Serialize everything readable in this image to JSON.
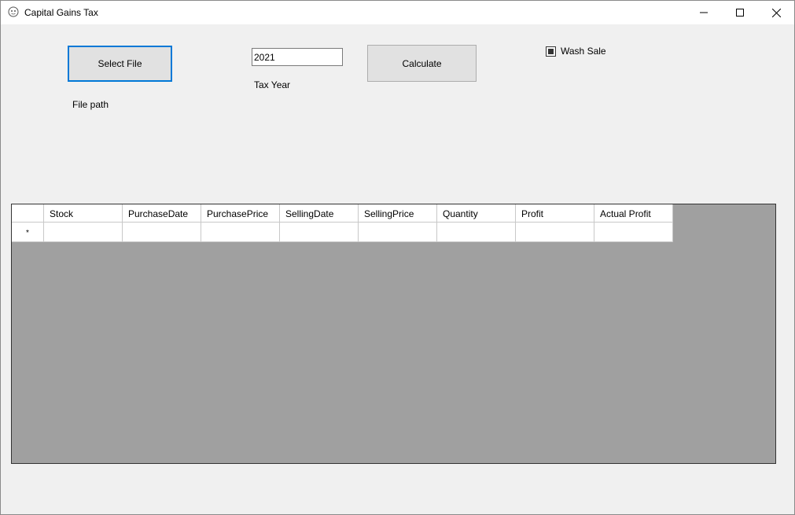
{
  "window": {
    "title": "Capital Gains Tax",
    "icon": "app-icon",
    "controls": [
      "minimize-icon",
      "maximize-icon",
      "close-icon"
    ]
  },
  "form": {
    "select_file_label": "Select File",
    "file_path_label": "File path",
    "tax_year_value": "2021",
    "tax_year_label": "Tax Year",
    "calculate_label": "Calculate",
    "wash_sale_label": "Wash Sale",
    "wash_sale_checked": true
  },
  "grid": {
    "columns": [
      "Stock",
      "PurchaseDate",
      "PurchasePrice",
      "SellingDate",
      "SellingPrice",
      "Quantity",
      "Profit",
      "Actual Profit"
    ],
    "new_row_marker": "*",
    "rows": []
  },
  "colors": {
    "accent": "#0078d7",
    "window_bg": "#f0f0f0",
    "grid_bg": "#a0a0a0",
    "button_bg": "#e1e1e1"
  }
}
